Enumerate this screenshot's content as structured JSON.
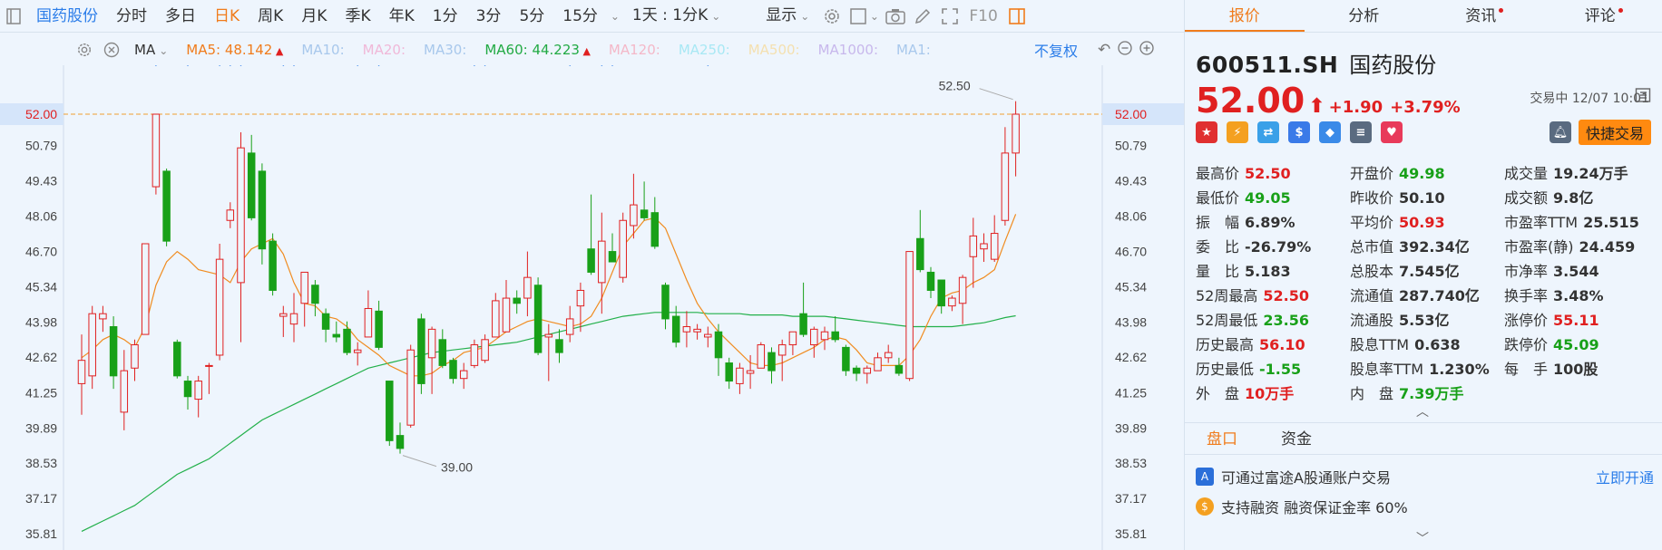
{
  "toolbar": {
    "stock_name": "国药股份",
    "periods": [
      "分时",
      "多日",
      "日K",
      "周K",
      "月K",
      "季K",
      "年K",
      "1分",
      "3分",
      "5分",
      "15分"
    ],
    "active_period": "日K",
    "range": "1天 : 1分K",
    "display": "显示",
    "f10": "F10"
  },
  "ma_bar": {
    "label": "MA",
    "items": [
      {
        "name": "MA5:",
        "value": "48.142",
        "color": "#f07c1c",
        "arrow": "▲",
        "arrow_color": "#e02020"
      },
      {
        "name": "MA10:",
        "value": "",
        "color": "#a8c8ec"
      },
      {
        "name": "MA20:",
        "value": "",
        "color": "#f0b8d8"
      },
      {
        "name": "MA30:",
        "value": "",
        "color": "#a8c8ec"
      },
      {
        "name": "MA60:",
        "value": "44.223",
        "color": "#22aa44",
        "arrow": "▲",
        "arrow_color": "#e02020"
      },
      {
        "name": "MA120:",
        "value": "",
        "color": "#f4b8c8"
      },
      {
        "name": "MA250:",
        "value": "",
        "color": "#a8e8f4"
      },
      {
        "name": "MA500:",
        "value": "",
        "color": "#f4e0b0"
      },
      {
        "name": "MA1000:",
        "value": "",
        "color": "#c8b8ec"
      },
      {
        "name": "MA1:",
        "value": "",
        "color": "#a8c8ec"
      }
    ],
    "restore": "不复权"
  },
  "chart_data": {
    "type": "candlestick",
    "y_ticks": [
      "52.00",
      "50.79",
      "49.43",
      "48.06",
      "46.70",
      "45.34",
      "43.98",
      "42.62",
      "41.25",
      "39.89",
      "38.53",
      "37.17",
      "35.81"
    ],
    "ylim": [
      35.81,
      52.0
    ],
    "current_price_label": "52.00",
    "high_annotation": "52.50",
    "low_annotation": "39.00",
    "candles": [
      {
        "o": 41.6,
        "c": 42.5,
        "h": 43.5,
        "l": 40.4
      },
      {
        "o": 41.9,
        "c": 44.3,
        "h": 44.6,
        "l": 41.4
      },
      {
        "o": 44.1,
        "c": 44.3,
        "h": 44.6,
        "l": 43.6
      },
      {
        "o": 43.8,
        "c": 41.9,
        "h": 44.2,
        "l": 41.4
      },
      {
        "o": 40.5,
        "c": 42.1,
        "h": 42.9,
        "l": 39.8
      },
      {
        "o": 42.2,
        "c": 43.1,
        "h": 43.3,
        "l": 41.7
      },
      {
        "o": 43.5,
        "c": 47.0,
        "h": 47.0,
        "l": 43.6
      },
      {
        "o": 49.2,
        "c": 52.0,
        "h": 52.0,
        "l": 48.9
      },
      {
        "o": 49.8,
        "c": 47.1,
        "h": 49.9,
        "l": 46.9
      },
      {
        "o": 43.2,
        "c": 41.9,
        "h": 43.3,
        "l": 41.8
      },
      {
        "o": 41.7,
        "c": 41.1,
        "h": 41.9,
        "l": 40.6
      },
      {
        "o": 41.0,
        "c": 41.7,
        "h": 41.9,
        "l": 40.3
      },
      {
        "o": 42.3,
        "c": 42.3,
        "h": 42.4,
        "l": 41.2
      },
      {
        "o": 42.7,
        "c": 46.4,
        "h": 47.0,
        "l": 42.5
      },
      {
        "o": 47.9,
        "c": 48.3,
        "h": 48.6,
        "l": 47.6
      },
      {
        "o": 45.5,
        "c": 50.7,
        "h": 51.3,
        "l": 43.2
      },
      {
        "o": 50.5,
        "c": 48.0,
        "h": 51.2,
        "l": 47.9
      },
      {
        "o": 49.8,
        "c": 46.8,
        "h": 50.1,
        "l": 46.2
      },
      {
        "o": 47.1,
        "c": 45.2,
        "h": 47.4,
        "l": 45.0
      },
      {
        "o": 44.2,
        "c": 44.3,
        "h": 44.6,
        "l": 43.4
      },
      {
        "o": 43.9,
        "c": 44.3,
        "h": 45.1,
        "l": 43.2
      },
      {
        "o": 44.7,
        "c": 45.9,
        "h": 45.9,
        "l": 43.8
      },
      {
        "o": 45.4,
        "c": 44.7,
        "h": 45.6,
        "l": 44.2
      },
      {
        "o": 44.3,
        "c": 43.7,
        "h": 44.5,
        "l": 43.2
      },
      {
        "o": 43.5,
        "c": 43.4,
        "h": 44.0,
        "l": 43.2
      },
      {
        "o": 43.7,
        "c": 42.8,
        "h": 44.0,
        "l": 42.7
      },
      {
        "o": 42.8,
        "c": 42.9,
        "h": 43.2,
        "l": 42.3
      },
      {
        "o": 43.4,
        "c": 44.5,
        "h": 45.2,
        "l": 43.4
      },
      {
        "o": 44.4,
        "c": 43.0,
        "h": 44.8,
        "l": 42.9
      },
      {
        "o": 41.7,
        "c": 39.4,
        "h": 41.7,
        "l": 39.2
      },
      {
        "o": 39.6,
        "c": 39.1,
        "h": 40.1,
        "l": 38.9
      },
      {
        "o": 40.0,
        "c": 42.9,
        "h": 43.1,
        "l": 39.9
      },
      {
        "o": 44.1,
        "c": 41.6,
        "h": 44.3,
        "l": 41.2
      },
      {
        "o": 42.6,
        "c": 43.7,
        "h": 43.8,
        "l": 41.2
      },
      {
        "o": 43.3,
        "c": 42.3,
        "h": 43.7,
        "l": 42.2
      },
      {
        "o": 42.5,
        "c": 41.8,
        "h": 42.6,
        "l": 41.6
      },
      {
        "o": 41.8,
        "c": 42.1,
        "h": 42.4,
        "l": 41.4
      },
      {
        "o": 42.3,
        "c": 43.1,
        "h": 43.3,
        "l": 42.2
      },
      {
        "o": 42.5,
        "c": 43.3,
        "h": 43.5,
        "l": 42.4
      },
      {
        "o": 43.4,
        "c": 44.8,
        "h": 45.1,
        "l": 43.4
      },
      {
        "o": 43.6,
        "c": 44.9,
        "h": 45.6,
        "l": 43.6
      },
      {
        "o": 44.9,
        "c": 44.7,
        "h": 45.2,
        "l": 44.3
      },
      {
        "o": 44.9,
        "c": 45.7,
        "h": 46.7,
        "l": 44.2
      },
      {
        "o": 45.4,
        "c": 42.8,
        "h": 45.7,
        "l": 42.7
      },
      {
        "o": 43.4,
        "c": 43.5,
        "h": 43.9,
        "l": 41.7
      },
      {
        "o": 43.3,
        "c": 42.8,
        "h": 43.7,
        "l": 42.4
      },
      {
        "o": 43.5,
        "c": 44.1,
        "h": 44.6,
        "l": 43.2
      },
      {
        "o": 44.6,
        "c": 45.2,
        "h": 45.5,
        "l": 43.6
      },
      {
        "o": 46.8,
        "c": 45.9,
        "h": 48.9,
        "l": 45.8
      },
      {
        "o": 45.5,
        "c": 47.1,
        "h": 48.2,
        "l": 44.3
      },
      {
        "o": 46.7,
        "c": 46.3,
        "h": 47.4,
        "l": 46.3
      },
      {
        "o": 45.7,
        "c": 47.9,
        "h": 48.2,
        "l": 45.5
      },
      {
        "o": 47.7,
        "c": 48.5,
        "h": 49.7,
        "l": 47.2
      },
      {
        "o": 48.3,
        "c": 48.0,
        "h": 49.4,
        "l": 47.9
      },
      {
        "o": 48.2,
        "c": 46.9,
        "h": 48.8,
        "l": 46.8
      },
      {
        "o": 45.4,
        "c": 44.1,
        "h": 45.5,
        "l": 43.7
      },
      {
        "o": 44.2,
        "c": 43.2,
        "h": 44.6,
        "l": 43.0
      },
      {
        "o": 43.6,
        "c": 43.8,
        "h": 44.4,
        "l": 43.0
      },
      {
        "o": 43.6,
        "c": 43.7,
        "h": 43.9,
        "l": 43.3
      },
      {
        "o": 43.4,
        "c": 43.5,
        "h": 43.8,
        "l": 43.0
      },
      {
        "o": 43.6,
        "c": 42.6,
        "h": 43.9,
        "l": 41.9
      },
      {
        "o": 42.4,
        "c": 41.7,
        "h": 42.6,
        "l": 41.4
      },
      {
        "o": 41.6,
        "c": 42.2,
        "h": 42.4,
        "l": 41.2
      },
      {
        "o": 42.0,
        "c": 42.1,
        "h": 42.7,
        "l": 41.4
      },
      {
        "o": 42.2,
        "c": 43.1,
        "h": 43.2,
        "l": 42.2
      },
      {
        "o": 42.8,
        "c": 42.1,
        "h": 43.0,
        "l": 41.6
      },
      {
        "o": 42.7,
        "c": 43.1,
        "h": 43.3,
        "l": 41.7
      },
      {
        "o": 43.1,
        "c": 43.6,
        "h": 43.6,
        "l": 42.7
      },
      {
        "o": 44.3,
        "c": 43.5,
        "h": 45.5,
        "l": 43.4
      },
      {
        "o": 43.1,
        "c": 43.7,
        "h": 43.8,
        "l": 42.6
      },
      {
        "o": 43.3,
        "c": 43.6,
        "h": 43.8,
        "l": 42.9
      },
      {
        "o": 43.6,
        "c": 43.3,
        "h": 44.2,
        "l": 43.2
      },
      {
        "o": 43.0,
        "c": 42.1,
        "h": 43.1,
        "l": 41.9
      },
      {
        "o": 42.2,
        "c": 42.0,
        "h": 42.3,
        "l": 41.7
      },
      {
        "o": 42.0,
        "c": 42.2,
        "h": 42.3,
        "l": 41.6
      },
      {
        "o": 42.1,
        "c": 42.6,
        "h": 42.8,
        "l": 42.1
      },
      {
        "o": 42.6,
        "c": 42.8,
        "h": 43.1,
        "l": 42.4
      },
      {
        "o": 42.3,
        "c": 42.0,
        "h": 42.6,
        "l": 41.9
      },
      {
        "o": 41.8,
        "c": 46.7,
        "h": 46.7,
        "l": 41.7
      },
      {
        "o": 47.2,
        "c": 46.0,
        "h": 48.3,
        "l": 45.9
      },
      {
        "o": 45.9,
        "c": 45.2,
        "h": 46.1,
        "l": 44.9
      },
      {
        "o": 45.6,
        "c": 44.6,
        "h": 45.6,
        "l": 44.3
      },
      {
        "o": 44.6,
        "c": 44.9,
        "h": 45.0,
        "l": 44.4
      },
      {
        "o": 44.7,
        "c": 45.7,
        "h": 45.8,
        "l": 43.9
      },
      {
        "o": 46.5,
        "c": 47.3,
        "h": 48.0,
        "l": 45.3
      },
      {
        "o": 46.8,
        "c": 47.0,
        "h": 47.4,
        "l": 46.3
      },
      {
        "o": 46.4,
        "c": 47.4,
        "h": 48.1,
        "l": 46.3
      },
      {
        "o": 47.9,
        "c": 50.5,
        "h": 51.5,
        "l": 47.7
      },
      {
        "o": 50.5,
        "c": 52.0,
        "h": 52.5,
        "l": 49.6
      }
    ],
    "ma5": [
      42.6,
      42.9,
      43.3,
      43.5,
      43.3,
      43.0,
      43.8,
      45.4,
      46.3,
      46.7,
      46.4,
      46.0,
      45.9,
      45.8,
      45.5,
      46.3,
      46.8,
      47.0,
      47.2,
      46.6,
      45.5,
      44.7,
      44.6,
      44.2,
      44.1,
      43.8,
      43.3,
      43.0,
      42.7,
      42.3,
      42.1,
      41.9,
      41.9,
      42.0,
      42.3,
      42.5,
      42.8,
      42.9,
      43.0,
      43.3,
      43.6,
      43.8,
      44.0,
      44.1,
      44.0,
      43.9,
      43.8,
      43.9,
      44.2,
      44.9,
      45.9,
      46.9,
      47.4,
      47.9,
      48.0,
      47.6,
      46.6,
      45.6,
      44.7,
      44.1,
      43.6,
      43.2,
      42.8,
      42.4,
      42.3,
      42.3,
      42.4,
      42.6,
      42.8,
      43.0,
      43.3,
      43.4,
      43.3,
      42.9,
      42.4,
      42.3,
      42.3,
      42.3,
      42.7,
      43.3,
      44.2,
      44.9,
      45.1,
      45.2,
      45.5,
      45.7,
      46.0,
      47.1,
      48.14
    ],
    "ma60": [
      35.9,
      36.1,
      36.3,
      36.5,
      36.7,
      36.9,
      37.2,
      37.5,
      37.8,
      38.1,
      38.3,
      38.5,
      38.7,
      39.0,
      39.3,
      39.6,
      39.9,
      40.2,
      40.4,
      40.6,
      40.8,
      41.0,
      41.2,
      41.4,
      41.6,
      41.8,
      42.0,
      42.2,
      42.3,
      42.4,
      42.5,
      42.6,
      42.7,
      42.8,
      42.85,
      42.9,
      42.95,
      43.0,
      43.05,
      43.1,
      43.15,
      43.2,
      43.3,
      43.4,
      43.5,
      43.6,
      43.7,
      43.8,
      43.9,
      44.0,
      44.1,
      44.2,
      44.25,
      44.3,
      44.35,
      44.35,
      44.35,
      44.35,
      44.35,
      44.3,
      44.3,
      44.3,
      44.3,
      44.25,
      44.25,
      44.25,
      44.25,
      44.2,
      44.2,
      44.2,
      44.2,
      44.15,
      44.1,
      44.05,
      44.0,
      43.95,
      43.9,
      43.85,
      43.8,
      43.8,
      43.8,
      43.8,
      43.8,
      43.85,
      43.9,
      43.95,
      44.05,
      44.15,
      44.22
    ],
    "markers_candle_index": [
      7,
      10,
      13,
      14,
      15,
      19,
      20,
      26,
      28,
      37,
      38,
      46,
      49,
      50,
      59
    ]
  },
  "quote": {
    "code": "600511.SH",
    "name": "国药股份",
    "price": "52.00",
    "arrow": "⬆",
    "change": "+1.90",
    "change_pct": "+3.79%",
    "status": "交易中 12/07 10:01",
    "quick_trade": "快捷交易"
  },
  "tabs": {
    "items": [
      "报价",
      "分析",
      "资讯",
      "评论"
    ],
    "active": "报价"
  },
  "stats": [
    [
      {
        "l": "最高价",
        "v": "52.50",
        "c": "red"
      },
      {
        "l": "开盘价",
        "v": "49.98",
        "c": "green"
      },
      {
        "l": "成交量",
        "v": "19.24万手",
        "c": "dark"
      }
    ],
    [
      {
        "l": "最低价",
        "v": "49.05",
        "c": "green"
      },
      {
        "l": "昨收价",
        "v": "50.10",
        "c": "dark"
      },
      {
        "l": "成交额",
        "v": "9.8亿",
        "c": "dark"
      }
    ],
    [
      {
        "l": "振　幅",
        "v": "6.89%",
        "c": "dark"
      },
      {
        "l": "平均价",
        "v": "50.93",
        "c": "red"
      },
      {
        "l": "市盈率TTM",
        "v": "25.515",
        "c": "dark"
      }
    ],
    [
      {
        "l": "委　比",
        "v": "-26.79%",
        "c": "dark"
      },
      {
        "l": "总市值",
        "v": "392.34亿",
        "c": "dark"
      },
      {
        "l": "市盈率(静)",
        "v": "24.459",
        "c": "dark"
      }
    ],
    [
      {
        "l": "量　比",
        "v": "5.183",
        "c": "dark"
      },
      {
        "l": "总股本",
        "v": "7.545亿",
        "c": "dark"
      },
      {
        "l": "市净率",
        "v": "3.544",
        "c": "dark"
      }
    ],
    [
      {
        "l": "52周最高",
        "v": "52.50",
        "c": "red"
      },
      {
        "l": "流通值",
        "v": "287.740亿",
        "c": "dark"
      },
      {
        "l": "换手率",
        "v": "3.48%",
        "c": "dark"
      }
    ],
    [
      {
        "l": "52周最低",
        "v": "23.56",
        "c": "green"
      },
      {
        "l": "流通股",
        "v": "5.53亿",
        "c": "dark"
      },
      {
        "l": "涨停价",
        "v": "55.11",
        "c": "red"
      }
    ],
    [
      {
        "l": "历史最高",
        "v": "56.10",
        "c": "red"
      },
      {
        "l": "股息TTM",
        "v": "0.638",
        "c": "dark"
      },
      {
        "l": "跌停价",
        "v": "45.09",
        "c": "green"
      }
    ],
    [
      {
        "l": "历史最低",
        "v": "-1.55",
        "c": "green"
      },
      {
        "l": "股息率TTM",
        "v": "1.230%",
        "c": "dark"
      },
      {
        "l": "每　手",
        "v": "100股",
        "c": "dark"
      }
    ],
    [
      {
        "l": "外　盘",
        "v": "10万手",
        "c": "red"
      },
      {
        "l": "内　盘",
        "v": "7.39万手",
        "c": "green"
      },
      {
        "l": "",
        "v": "",
        "c": "dark"
      }
    ]
  ],
  "bottom_tabs": {
    "items": [
      "盘口",
      "资金"
    ],
    "active": "盘口"
  },
  "promo": {
    "line1": "可通过富途A股通账户交易",
    "open_now": "立即开通",
    "line2": "支持融资 融资保证金率 60%"
  },
  "colors": {
    "up": "#e02020",
    "down": "#18a018",
    "accent": "#f07c1c",
    "link": "#2b7de9"
  }
}
